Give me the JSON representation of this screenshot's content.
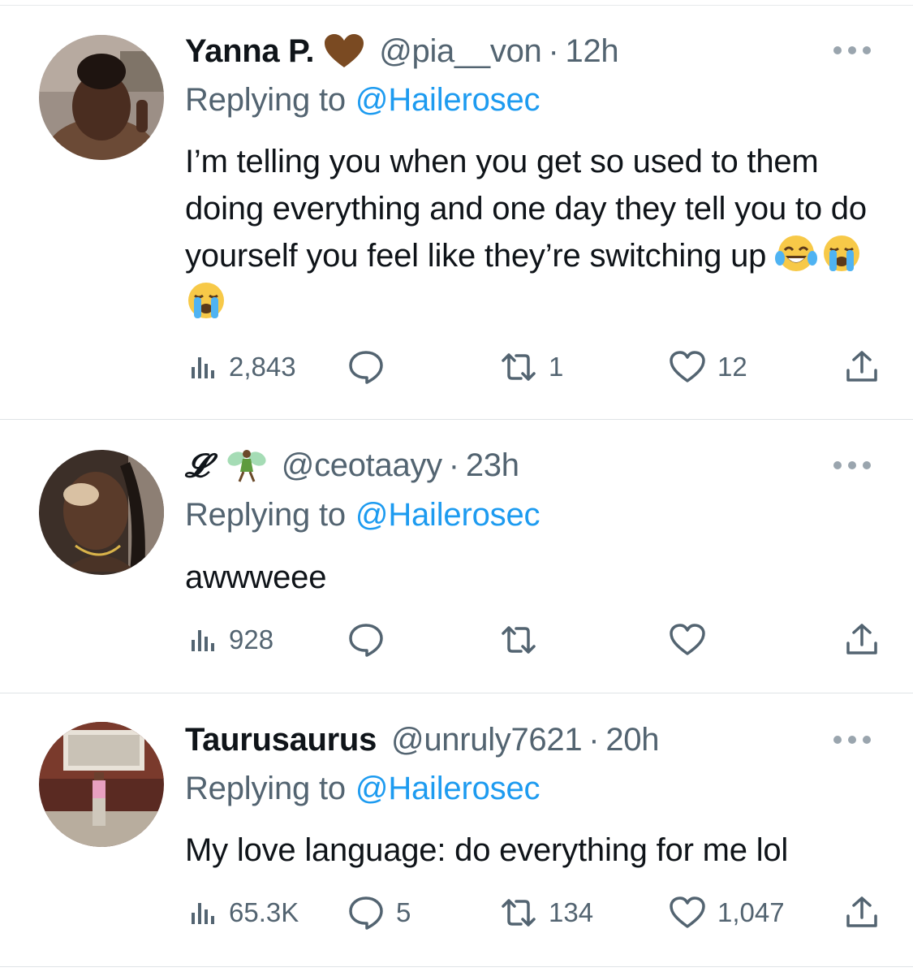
{
  "tweets": [
    {
      "display_name": "Yanna P.",
      "name_emoji": "brown-heart",
      "handle": "@pia__von",
      "separator": "·",
      "time": "12h",
      "replying_prefix": "Replying to",
      "replying_to": "@Hailerosec",
      "text": "I’m telling you when you get so used to them doing everything and one day they tell you to do yourself you feel like they’re switching up",
      "text_emojis": [
        "tears-of-joy",
        "loudly-crying",
        "loudly-crying"
      ],
      "views": "2,843",
      "replies": "",
      "retweets": "1",
      "likes": "12"
    },
    {
      "display_name": "𝓛",
      "name_emoji": "fairy",
      "handle": "@ceotaayy",
      "separator": "·",
      "time": "23h",
      "replying_prefix": "Replying to",
      "replying_to": "@Hailerosec",
      "text": "awwweee",
      "text_emojis": [],
      "views": "928",
      "replies": "",
      "retweets": "",
      "likes": ""
    },
    {
      "display_name": "Taurusaurus",
      "name_emoji": "",
      "handle": "@unruly7621",
      "separator": "·",
      "time": "20h",
      "replying_prefix": "Replying to",
      "replying_to": "@Hailerosec",
      "text": "My love language: do everything for me lol",
      "text_emojis": [],
      "views": "65.3K",
      "replies": "5",
      "retweets": "134",
      "likes": "1,047"
    }
  ],
  "colors": {
    "text": "#0f1419",
    "secondary": "#536471",
    "link": "#1d9bf0",
    "divider": "#dfe3e6"
  },
  "icons": [
    "views-icon",
    "reply-icon",
    "retweet-icon",
    "like-icon",
    "share-icon",
    "more-icon"
  ]
}
